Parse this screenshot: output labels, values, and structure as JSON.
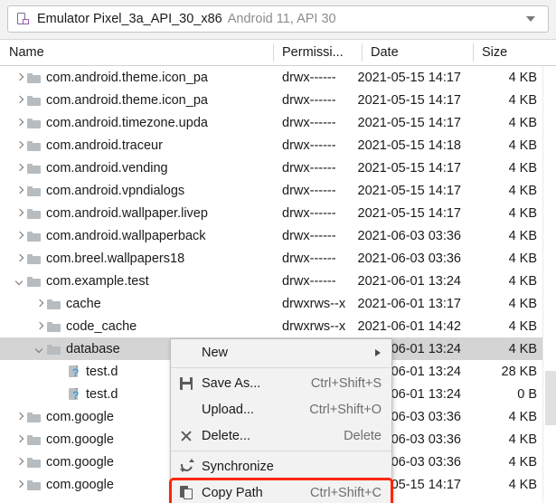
{
  "device_selector": {
    "icon": "android-device-icon",
    "name": "Emulator Pixel_3a_API_30_x86",
    "meta": "Android 11, API 30",
    "dropdown_icon": "chevron-down-icon"
  },
  "table": {
    "columns": [
      {
        "key": "name",
        "label": "Name"
      },
      {
        "key": "permissions",
        "label": "Permissi..."
      },
      {
        "key": "date",
        "label": "Date"
      },
      {
        "key": "size",
        "label": "Size"
      }
    ],
    "rows": [
      {
        "name": "com.android.theme.icon_pa",
        "icon": "folder-icon",
        "twisty": "right",
        "indent": 1,
        "permissions": "drwx------",
        "date": "2021-05-15 14:17",
        "size": "4 KB",
        "selected": false
      },
      {
        "name": "com.android.theme.icon_pa",
        "icon": "folder-icon",
        "twisty": "right",
        "indent": 1,
        "permissions": "drwx------",
        "date": "2021-05-15 14:17",
        "size": "4 KB",
        "selected": false
      },
      {
        "name": "com.android.timezone.upda",
        "icon": "folder-icon",
        "twisty": "right",
        "indent": 1,
        "permissions": "drwx------",
        "date": "2021-05-15 14:17",
        "size": "4 KB",
        "selected": false
      },
      {
        "name": "com.android.traceur",
        "icon": "folder-icon",
        "twisty": "right",
        "indent": 1,
        "permissions": "drwx------",
        "date": "2021-05-15 14:18",
        "size": "4 KB",
        "selected": false
      },
      {
        "name": "com.android.vending",
        "icon": "folder-icon",
        "twisty": "right",
        "indent": 1,
        "permissions": "drwx------",
        "date": "2021-05-15 14:17",
        "size": "4 KB",
        "selected": false
      },
      {
        "name": "com.android.vpndialogs",
        "icon": "folder-icon",
        "twisty": "right",
        "indent": 1,
        "permissions": "drwx------",
        "date": "2021-05-15 14:17",
        "size": "4 KB",
        "selected": false
      },
      {
        "name": "com.android.wallpaper.livep",
        "icon": "folder-icon",
        "twisty": "right",
        "indent": 1,
        "permissions": "drwx------",
        "date": "2021-05-15 14:17",
        "size": "4 KB",
        "selected": false
      },
      {
        "name": "com.android.wallpaperback",
        "icon": "folder-icon",
        "twisty": "right",
        "indent": 1,
        "permissions": "drwx------",
        "date": "2021-06-03 03:36",
        "size": "4 KB",
        "selected": false
      },
      {
        "name": "com.breel.wallpapers18",
        "icon": "folder-icon",
        "twisty": "right",
        "indent": 1,
        "permissions": "drwx------",
        "date": "2021-06-03 03:36",
        "size": "4 KB",
        "selected": false
      },
      {
        "name": "com.example.test",
        "icon": "folder-icon",
        "twisty": "down",
        "indent": 1,
        "permissions": "drwx------",
        "date": "2021-06-01 13:24",
        "size": "4 KB",
        "selected": false
      },
      {
        "name": "cache",
        "icon": "folder-icon",
        "twisty": "right",
        "indent": 2,
        "permissions": "drwxrws--x",
        "date": "2021-06-01 13:17",
        "size": "4 KB",
        "selected": false
      },
      {
        "name": "code_cache",
        "icon": "folder-icon",
        "twisty": "right",
        "indent": 2,
        "permissions": "drwxrws--x",
        "date": "2021-06-01 14:42",
        "size": "4 KB",
        "selected": false
      },
      {
        "name": "database",
        "icon": "folder-icon",
        "twisty": "down",
        "indent": 2,
        "permissions": "",
        "date": "-06-01 13:24",
        "size": "4 KB",
        "selected": true
      },
      {
        "name": "test.d",
        "icon": "unknown-file-icon",
        "twisty": "none",
        "indent": 3,
        "permissions": "",
        "date": "-06-01 13:24",
        "size": "28 KB",
        "selected": false
      },
      {
        "name": "test.d",
        "icon": "unknown-file-icon",
        "twisty": "none",
        "indent": 3,
        "permissions": "",
        "date": "-06-01 13:24",
        "size": "0 B",
        "selected": false
      },
      {
        "name": "com.google",
        "icon": "folder-icon",
        "twisty": "right",
        "indent": 1,
        "permissions": "",
        "date": "-06-03 03:36",
        "size": "4 KB",
        "selected": false
      },
      {
        "name": "com.google",
        "icon": "folder-icon",
        "twisty": "right",
        "indent": 1,
        "permissions": "",
        "date": "-06-03 03:36",
        "size": "4 KB",
        "selected": false
      },
      {
        "name": "com.google",
        "icon": "folder-icon",
        "twisty": "right",
        "indent": 1,
        "permissions": "",
        "date": "-06-03 03:36",
        "size": "4 KB",
        "selected": false
      },
      {
        "name": "com.google",
        "icon": "folder-icon",
        "twisty": "right",
        "indent": 1,
        "permissions": "",
        "date": "-05-15 14:17",
        "size": "4 KB",
        "selected": false
      }
    ]
  },
  "context_menu": {
    "items": [
      {
        "label": "New",
        "accel": "",
        "icon": "none",
        "submenu": true,
        "highlighted": false,
        "separator_after": true
      },
      {
        "label": "Save As...",
        "accel": "Ctrl+Shift+S",
        "icon": "save-icon",
        "submenu": false,
        "highlighted": false,
        "separator_after": false
      },
      {
        "label": "Upload...",
        "accel": "Ctrl+Shift+O",
        "icon": "none",
        "submenu": false,
        "highlighted": false,
        "separator_after": false
      },
      {
        "label": "Delete...",
        "accel": "Delete",
        "icon": "close-icon",
        "submenu": false,
        "highlighted": false,
        "separator_after": true
      },
      {
        "label": "Synchronize",
        "accel": "",
        "icon": "sync-icon",
        "submenu": false,
        "highlighted": false,
        "separator_after": false
      },
      {
        "label": "Copy Path",
        "accel": "Ctrl+Shift+C",
        "icon": "copy-icon",
        "submenu": false,
        "highlighted": true,
        "separator_after": false
      }
    ]
  },
  "scrollbar": {
    "name": "vertical-scrollbar"
  },
  "colors": {
    "highlight_box": "#ff2600",
    "selection": "#d4d4d4",
    "folder": "#b6bcc0",
    "accent_blue": "#3f9ad6",
    "menu_bg": "#f2f2f2"
  }
}
